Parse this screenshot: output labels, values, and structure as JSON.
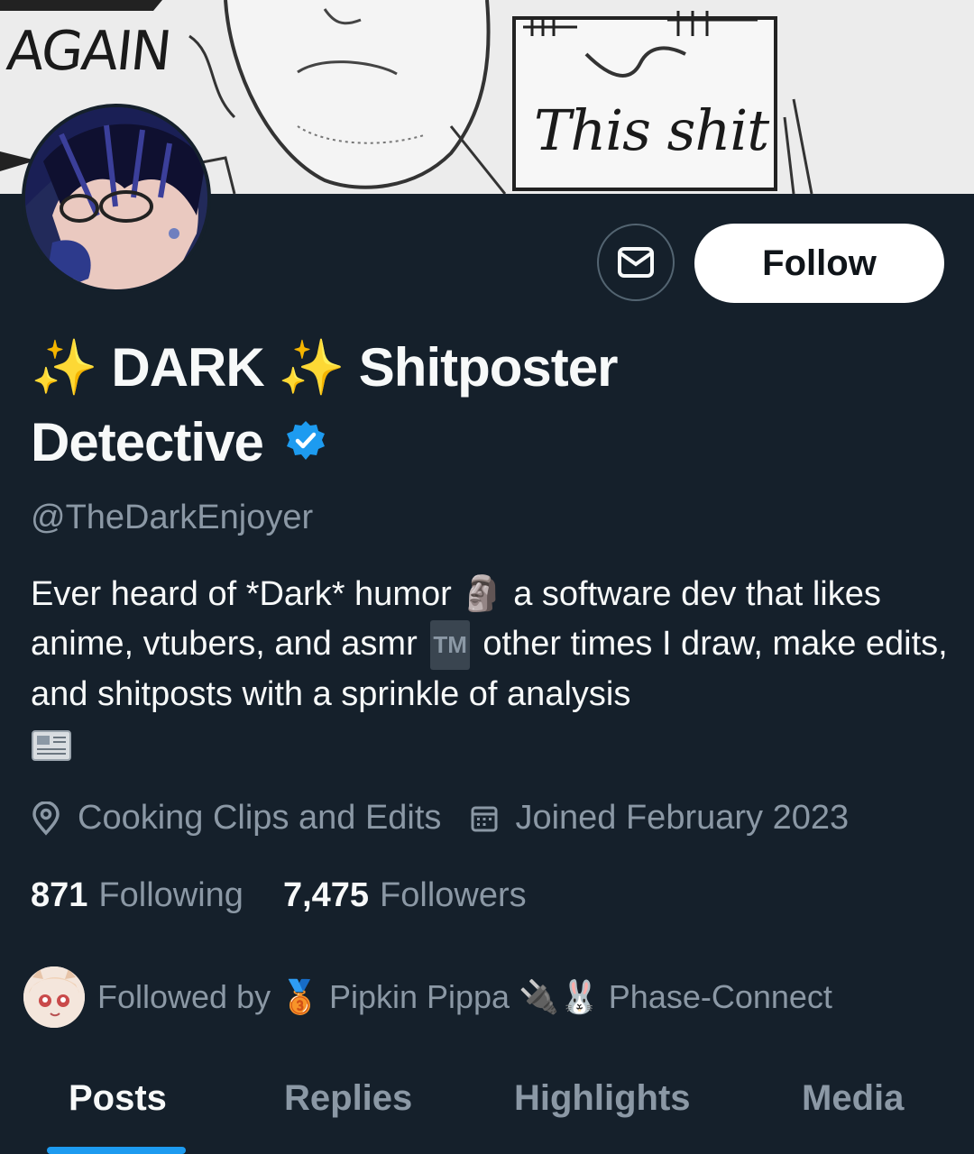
{
  "banner": {
    "text_left": "AGAIN",
    "text_sign": "This shit"
  },
  "actions": {
    "message_icon": "envelope-icon",
    "follow_label": "Follow"
  },
  "profile": {
    "name_line1_part1": "DARK",
    "name_line1_part2": "Shitposter",
    "name_line2": "Detective",
    "sparkle": "✨",
    "verified_icon": "verified-badge-icon",
    "handle": "@TheDarkEnjoyer",
    "bio_1": "Ever heard of *Dark* humor",
    "bio_emoji_1": "🗿",
    "bio_2": " a software dev that likes anime, vtubers, and asmr",
    "bio_tm": "TM",
    "bio_3": " other times I draw, make edits, and shitposts with a sprinkle of analysis",
    "bio_emoji_2": "newspaper-icon",
    "location": "Cooking Clips and Edits",
    "joined": "Joined February 2023",
    "following_count": "871",
    "following_label": "Following",
    "followers_count": "7,475",
    "followers_label": "Followers",
    "followed_by_label": "Followed by",
    "followed_medal": "🥉",
    "followed_name_1": "Pipkin Pippa",
    "followed_emoji_1": "🔌",
    "followed_emoji_2": "🐰",
    "followed_name_2": "Phase-Connect"
  },
  "tabs": [
    "Posts",
    "Replies",
    "Highlights",
    "Media"
  ],
  "colors": {
    "background": "#15202b",
    "accent": "#1d9bf0",
    "muted": "#8b98a5"
  }
}
